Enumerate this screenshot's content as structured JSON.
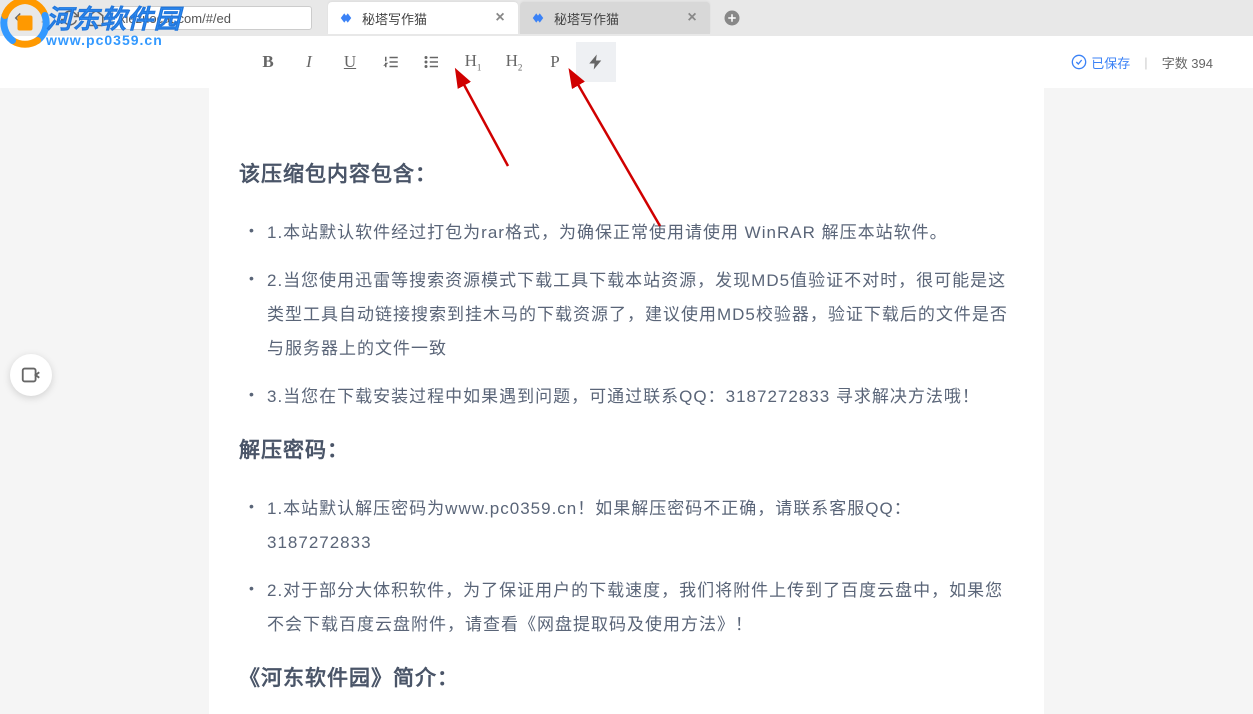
{
  "browser": {
    "url": "xiezuocat.com/#/ed",
    "tabs": [
      {
        "title": "秘塔写作猫",
        "active": true
      },
      {
        "title": "秘塔写作猫",
        "active": false
      }
    ]
  },
  "watermark": {
    "title": "河东软件园",
    "url": "www.pc0359.cn"
  },
  "toolbar": {
    "bold": "B",
    "italic": "I",
    "underline": "U",
    "h1": "H",
    "h1_sub": "1",
    "h2": "H",
    "h2_sub": "2",
    "paragraph": "P",
    "saved_text": "已保存",
    "word_count": "字数 394"
  },
  "content": {
    "section1_title": "该压缩包内容包含：",
    "section1_items": [
      "1.本站默认软件经过打包为rar格式，为确保正常使用请使用 WinRAR 解压本站软件。",
      "2.当您使用迅雷等搜索资源模式下载工具下载本站资源，发现MD5值验证不对时，很可能是这类型工具自动链接搜索到挂木马的下载资源了，建议使用MD5校验器，验证下载后的文件是否与服务器上的文件一致",
      "3.当您在下载安装过程中如果遇到问题，可通过联系QQ：3187272833 寻求解决方法哦！"
    ],
    "section2_title": "解压密码：",
    "section2_items": [
      "1.本站默认解压密码为www.pc0359.cn！如果解压密码不正确，请联系客服QQ：3187272833",
      "2.对于部分大体积软件，为了保证用户的下载速度，我们将附件上传到了百度云盘中，如果您不会下载百度云盘附件，请查看《网盘提取码及使用方法》！"
    ],
    "section3_title": "《河东软件园》简介："
  }
}
